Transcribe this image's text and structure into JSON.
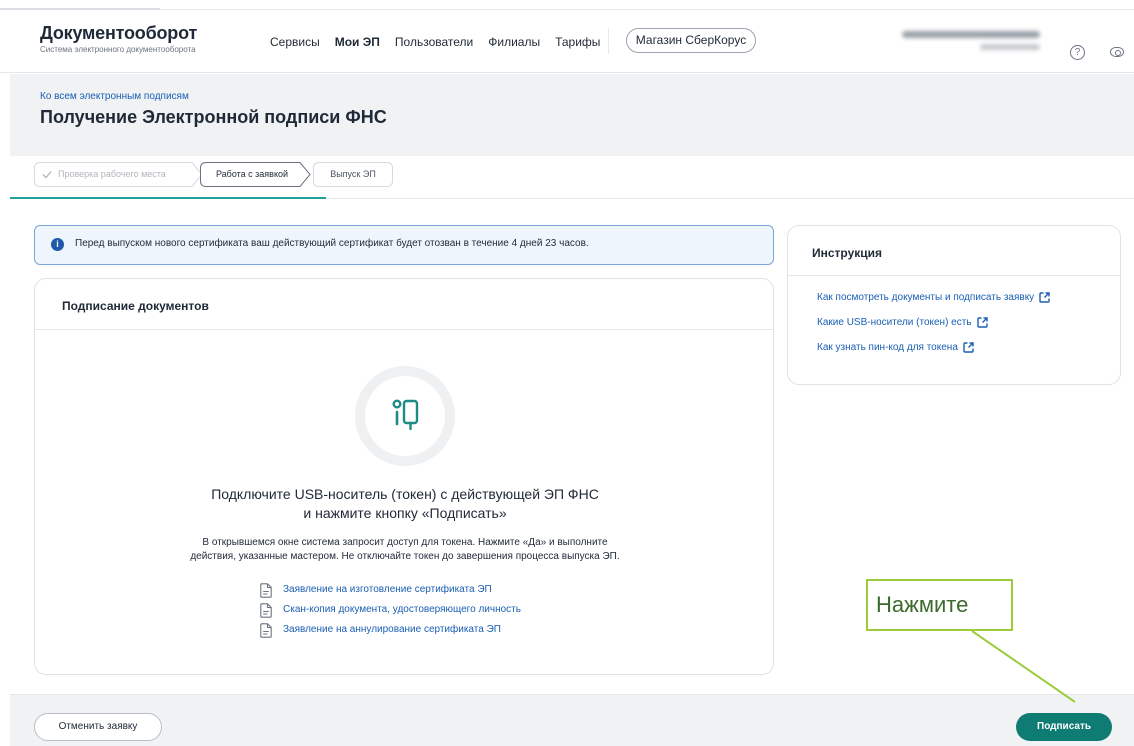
{
  "header": {
    "logo_title": "Документооборот",
    "logo_subtitle": "Система электронного документооборота",
    "nav": [
      "Сервисы",
      "Мои ЭП",
      "Пользователи",
      "Филиалы",
      "Тарифы"
    ],
    "active_nav": "Мои ЭП",
    "store_button": "Магазин СберКорус",
    "help_icon": "help-icon",
    "eye_icon": "eye-icon"
  },
  "titlebar": {
    "back_link": "Ко всем электронным подписям",
    "title": "Получение Электронной подписи ФНС"
  },
  "steps": [
    {
      "label": "Проверка рабочего места",
      "state": "done"
    },
    {
      "label": "Работа с заявкой",
      "state": "current"
    },
    {
      "label": "Выпуск ЭП",
      "state": "pending"
    }
  ],
  "alert": {
    "text": "Перед выпуском нового сертификата ваш действующий сертификат будет отозван в течение 4 дней 23 часов."
  },
  "signing_card": {
    "title": "Подписание документов",
    "main_line1": "Подключите USB-носитель (токен) с действующей ЭП ФНС",
    "main_line2": "и нажмите кнопку «Подписать»",
    "sub_line1": "В открывшемся окне система запросит доступ для токена. Нажмите «Да» и выполните",
    "sub_line2": "действия, указанные мастером. Не отключайте токен до завершения процесса выпуска ЭП.",
    "documents": [
      "Заявление на изготовление сертификата ЭП",
      "Скан-копия документа, удостоверяющего личность",
      "Заявление на аннулирование сертификата ЭП"
    ]
  },
  "instructions": {
    "title": "Инструкция",
    "links": [
      "Как посмотреть документы и подписать заявку",
      "Какие USB-носители (токен) есть",
      "Как узнать пин-код для токена"
    ]
  },
  "footer": {
    "cancel_button": "Отменить заявку",
    "sign_button": "Подписать"
  },
  "callout": {
    "text": "Нажмите"
  },
  "colors": {
    "accent": "#0f7c74",
    "link": "#1a5fb4",
    "callout_border": "#9ccc3c"
  }
}
